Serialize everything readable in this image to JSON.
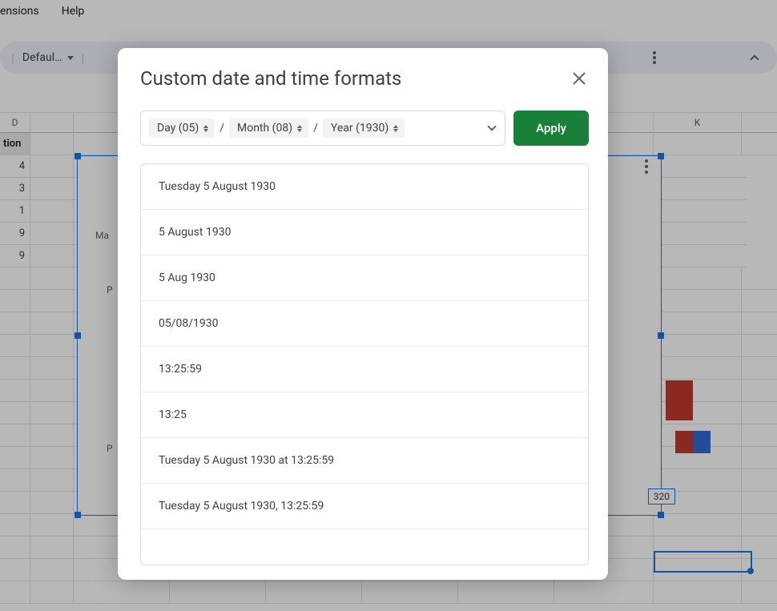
{
  "menubar": {
    "item1": "ensions",
    "item2": "Help"
  },
  "toolbar": {
    "font_dropdown": "Defaul…"
  },
  "columns": [
    "D",
    "K"
  ],
  "col_d_header": "tion",
  "col_d_values": [
    "4",
    "3",
    "1",
    "9",
    "9"
  ],
  "chart": {
    "labels": {
      "l1": "Ma",
      "l2": "P",
      "l3": "P"
    },
    "datalabel": "320"
  },
  "dialog": {
    "title": "Custom date and time formats",
    "tokens": {
      "day": "Day (05)",
      "month": "Month (08)",
      "year": "Year (1930)"
    },
    "separator": "/",
    "apply": "Apply",
    "options": [
      "Tuesday 5 August 1930",
      "5 August 1930",
      "5 Aug 1930",
      "05/08/1930",
      "13:25:59",
      "13:25",
      "Tuesday 5 August 1930 at 13:25:59",
      "Tuesday 5 August 1930, 13:25:59"
    ]
  }
}
